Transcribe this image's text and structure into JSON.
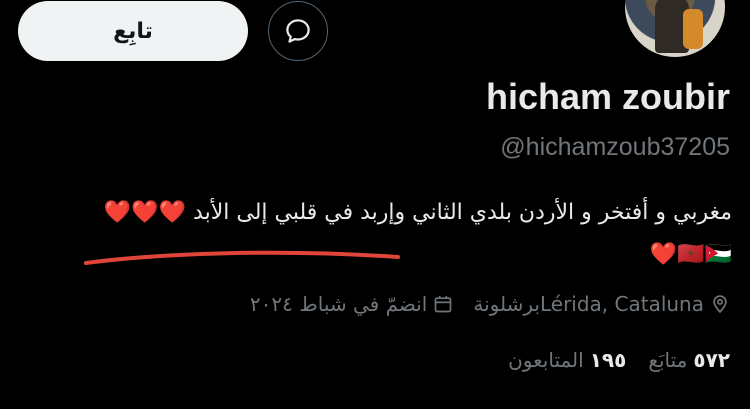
{
  "profile": {
    "name": "hicham zoubir",
    "handle": "@hichamzoub37205",
    "bio_line1": "مغربي و أفتخر و الأردن بلدي الثاني وإربد في قلبي إلى الأبد ❤️❤️❤️",
    "bio_line2": "🇲🇦🇯🇴❤️"
  },
  "actions": {
    "follow_label": "تابِع"
  },
  "meta": {
    "location": "Lérida, Catalunaبرشلونة",
    "joined": "انضمّ في شباط ٢٠٢٤"
  },
  "stats": {
    "following_count": "٥٧٢",
    "following_label": "متابَع",
    "followers_count": "١٩٥",
    "followers_label": "المتابعون"
  },
  "icons": {
    "message": "message-icon",
    "location": "location-pin-icon",
    "calendar": "calendar-icon"
  },
  "colors": {
    "background": "#000000",
    "primary_text": "#e7e9ea",
    "secondary_text": "#71767b",
    "button_bg": "#eff3f4",
    "annotation": "#e0453a"
  }
}
